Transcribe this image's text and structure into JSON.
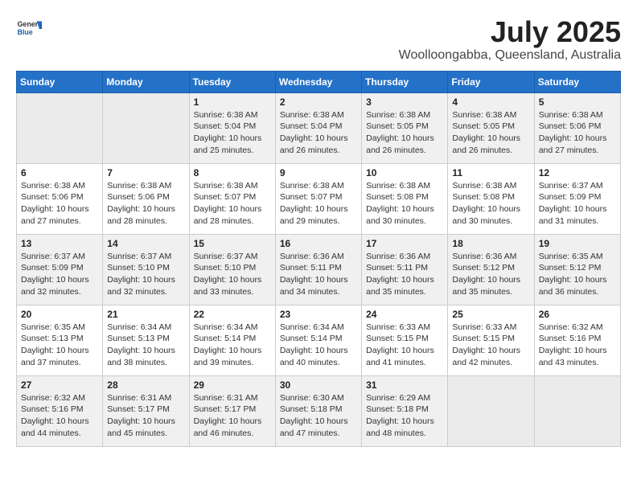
{
  "header": {
    "logo": {
      "general": "General",
      "blue": "Blue"
    },
    "title": "July 2025",
    "location": "Woolloongabba, Queensland, Australia"
  },
  "weekdays": [
    "Sunday",
    "Monday",
    "Tuesday",
    "Wednesday",
    "Thursday",
    "Friday",
    "Saturday"
  ],
  "weeks": [
    [
      {
        "day": "",
        "info": ""
      },
      {
        "day": "",
        "info": ""
      },
      {
        "day": "1",
        "info": "Sunrise: 6:38 AM\nSunset: 5:04 PM\nDaylight: 10 hours\nand 25 minutes."
      },
      {
        "day": "2",
        "info": "Sunrise: 6:38 AM\nSunset: 5:04 PM\nDaylight: 10 hours\nand 26 minutes."
      },
      {
        "day": "3",
        "info": "Sunrise: 6:38 AM\nSunset: 5:05 PM\nDaylight: 10 hours\nand 26 minutes."
      },
      {
        "day": "4",
        "info": "Sunrise: 6:38 AM\nSunset: 5:05 PM\nDaylight: 10 hours\nand 26 minutes."
      },
      {
        "day": "5",
        "info": "Sunrise: 6:38 AM\nSunset: 5:06 PM\nDaylight: 10 hours\nand 27 minutes."
      }
    ],
    [
      {
        "day": "6",
        "info": "Sunrise: 6:38 AM\nSunset: 5:06 PM\nDaylight: 10 hours\nand 27 minutes."
      },
      {
        "day": "7",
        "info": "Sunrise: 6:38 AM\nSunset: 5:06 PM\nDaylight: 10 hours\nand 28 minutes."
      },
      {
        "day": "8",
        "info": "Sunrise: 6:38 AM\nSunset: 5:07 PM\nDaylight: 10 hours\nand 28 minutes."
      },
      {
        "day": "9",
        "info": "Sunrise: 6:38 AM\nSunset: 5:07 PM\nDaylight: 10 hours\nand 29 minutes."
      },
      {
        "day": "10",
        "info": "Sunrise: 6:38 AM\nSunset: 5:08 PM\nDaylight: 10 hours\nand 30 minutes."
      },
      {
        "day": "11",
        "info": "Sunrise: 6:38 AM\nSunset: 5:08 PM\nDaylight: 10 hours\nand 30 minutes."
      },
      {
        "day": "12",
        "info": "Sunrise: 6:37 AM\nSunset: 5:09 PM\nDaylight: 10 hours\nand 31 minutes."
      }
    ],
    [
      {
        "day": "13",
        "info": "Sunrise: 6:37 AM\nSunset: 5:09 PM\nDaylight: 10 hours\nand 32 minutes."
      },
      {
        "day": "14",
        "info": "Sunrise: 6:37 AM\nSunset: 5:10 PM\nDaylight: 10 hours\nand 32 minutes."
      },
      {
        "day": "15",
        "info": "Sunrise: 6:37 AM\nSunset: 5:10 PM\nDaylight: 10 hours\nand 33 minutes."
      },
      {
        "day": "16",
        "info": "Sunrise: 6:36 AM\nSunset: 5:11 PM\nDaylight: 10 hours\nand 34 minutes."
      },
      {
        "day": "17",
        "info": "Sunrise: 6:36 AM\nSunset: 5:11 PM\nDaylight: 10 hours\nand 35 minutes."
      },
      {
        "day": "18",
        "info": "Sunrise: 6:36 AM\nSunset: 5:12 PM\nDaylight: 10 hours\nand 35 minutes."
      },
      {
        "day": "19",
        "info": "Sunrise: 6:35 AM\nSunset: 5:12 PM\nDaylight: 10 hours\nand 36 minutes."
      }
    ],
    [
      {
        "day": "20",
        "info": "Sunrise: 6:35 AM\nSunset: 5:13 PM\nDaylight: 10 hours\nand 37 minutes."
      },
      {
        "day": "21",
        "info": "Sunrise: 6:34 AM\nSunset: 5:13 PM\nDaylight: 10 hours\nand 38 minutes."
      },
      {
        "day": "22",
        "info": "Sunrise: 6:34 AM\nSunset: 5:14 PM\nDaylight: 10 hours\nand 39 minutes."
      },
      {
        "day": "23",
        "info": "Sunrise: 6:34 AM\nSunset: 5:14 PM\nDaylight: 10 hours\nand 40 minutes."
      },
      {
        "day": "24",
        "info": "Sunrise: 6:33 AM\nSunset: 5:15 PM\nDaylight: 10 hours\nand 41 minutes."
      },
      {
        "day": "25",
        "info": "Sunrise: 6:33 AM\nSunset: 5:15 PM\nDaylight: 10 hours\nand 42 minutes."
      },
      {
        "day": "26",
        "info": "Sunrise: 6:32 AM\nSunset: 5:16 PM\nDaylight: 10 hours\nand 43 minutes."
      }
    ],
    [
      {
        "day": "27",
        "info": "Sunrise: 6:32 AM\nSunset: 5:16 PM\nDaylight: 10 hours\nand 44 minutes."
      },
      {
        "day": "28",
        "info": "Sunrise: 6:31 AM\nSunset: 5:17 PM\nDaylight: 10 hours\nand 45 minutes."
      },
      {
        "day": "29",
        "info": "Sunrise: 6:31 AM\nSunset: 5:17 PM\nDaylight: 10 hours\nand 46 minutes."
      },
      {
        "day": "30",
        "info": "Sunrise: 6:30 AM\nSunset: 5:18 PM\nDaylight: 10 hours\nand 47 minutes."
      },
      {
        "day": "31",
        "info": "Sunrise: 6:29 AM\nSunset: 5:18 PM\nDaylight: 10 hours\nand 48 minutes."
      },
      {
        "day": "",
        "info": ""
      },
      {
        "day": "",
        "info": ""
      }
    ]
  ]
}
